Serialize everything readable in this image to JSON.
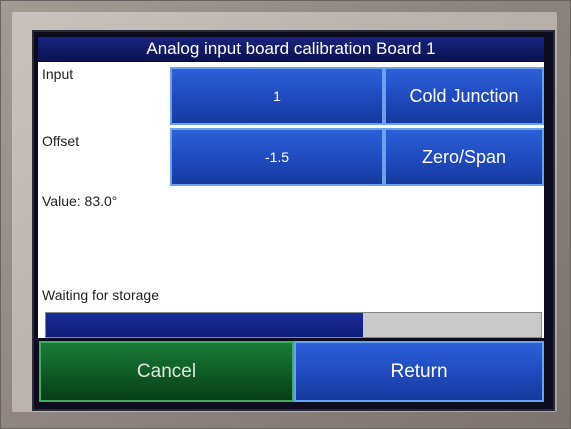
{
  "title": "Analog input board calibration Board 1",
  "input": {
    "label": "Input",
    "value": "1"
  },
  "offset": {
    "label": "Offset",
    "value": "-1.5"
  },
  "buttons": {
    "cold_junction": "Cold Junction",
    "zero_span": "Zero/Span",
    "cancel": "Cancel",
    "return": "Return"
  },
  "value_text": "Value: 83.0°",
  "status_text": "Waiting for storage",
  "progress": {
    "percent": 64
  },
  "colors": {
    "title_bar": "#0b1150",
    "button_blue": "#1f49bd",
    "cancel_green": "#0f5a27",
    "progress_fill": "#1a2c9a",
    "progress_track": "#c9c9c9"
  }
}
